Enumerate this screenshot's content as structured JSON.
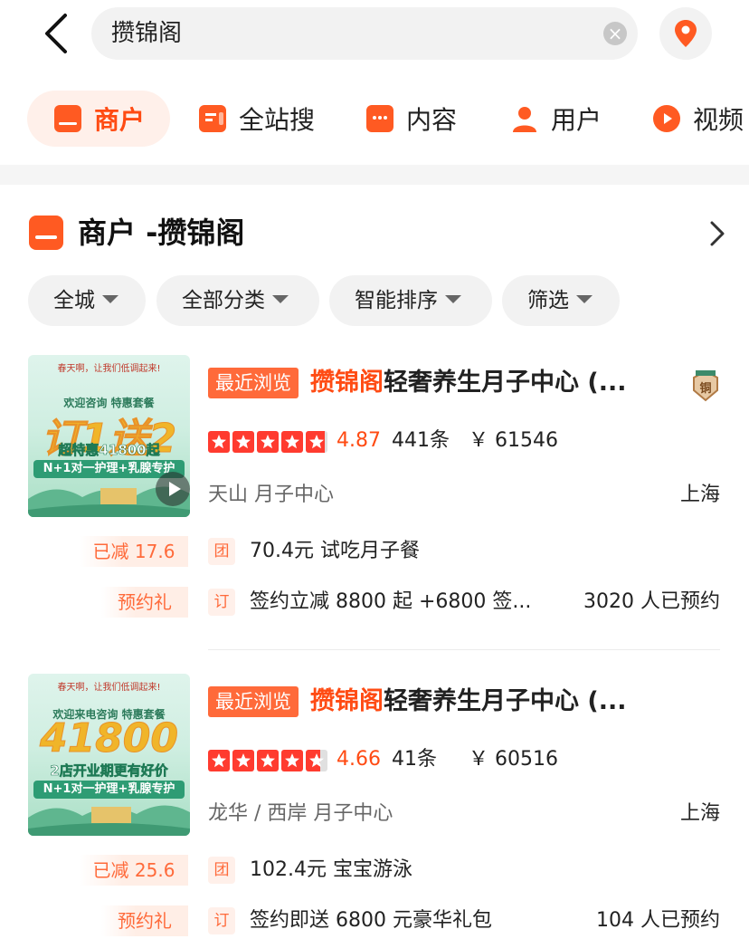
{
  "search": {
    "query": "攒锦阁",
    "clear": "×"
  },
  "tabs": [
    {
      "label": "商户",
      "icon": "shop-icon"
    },
    {
      "label": "全站搜",
      "icon": "document-icon"
    },
    {
      "label": "内容",
      "icon": "chat-icon"
    },
    {
      "label": "用户",
      "icon": "user-icon"
    },
    {
      "label": "视频",
      "icon": "play-icon"
    }
  ],
  "section": {
    "title": "商户 -攒锦阁"
  },
  "filters": [
    "全城",
    "全部分类",
    "智能排序",
    "筛选"
  ],
  "colors": {
    "accent": "#ff4b13",
    "tag_bg": "#ff6a3a"
  },
  "results": [
    {
      "thumb": {
        "top": "春天啊，让我们低调起来!",
        "sub": "欢迎咨询   特惠套餐",
        "big": "订1送2",
        "line": "超特惠41800起",
        "bar": "N+1对一护理+乳腺专护",
        "video": true
      },
      "recent": "最近浏览",
      "name_hl": "攒锦阁",
      "name_rest": "轻奢养生月子中心 (...",
      "medal": "铜",
      "rating_value": 4.87,
      "rating": "4.87",
      "reviews": "441条",
      "price": "￥ 61546",
      "area": "天山  月子中心",
      "city": "上海",
      "deal": {
        "side": "已减 17.6",
        "tag": "团",
        "text": "70.4元 试吃月子餐"
      },
      "gift": {
        "side": "预约礼",
        "tag": "订",
        "text": "签约立减 8800 起 +6800 签...",
        "count": "3020 人已预约"
      }
    },
    {
      "thumb": {
        "top": "春天啊，让我们低调起来!",
        "sub": "欢迎来电咨询  特惠套餐",
        "big": "41800",
        "line": "2店开业期更有好价",
        "bar": "N+1对一护理+乳腺专护",
        "video": false
      },
      "recent": "最近浏览",
      "name_hl": "攒锦阁",
      "name_rest": "轻奢养生月子中心 (...",
      "medal": "",
      "rating_value": 4.66,
      "rating": "4.66",
      "reviews": "41条",
      "price": "￥ 60516",
      "area": "龙华 / 西岸  月子中心",
      "city": "上海",
      "deal": {
        "side": "已减 25.6",
        "tag": "团",
        "text": "102.4元 宝宝游泳"
      },
      "gift": {
        "side": "预约礼",
        "tag": "订",
        "text": "签约即送 6800 元豪华礼包",
        "count": "104 人已预约"
      }
    }
  ]
}
